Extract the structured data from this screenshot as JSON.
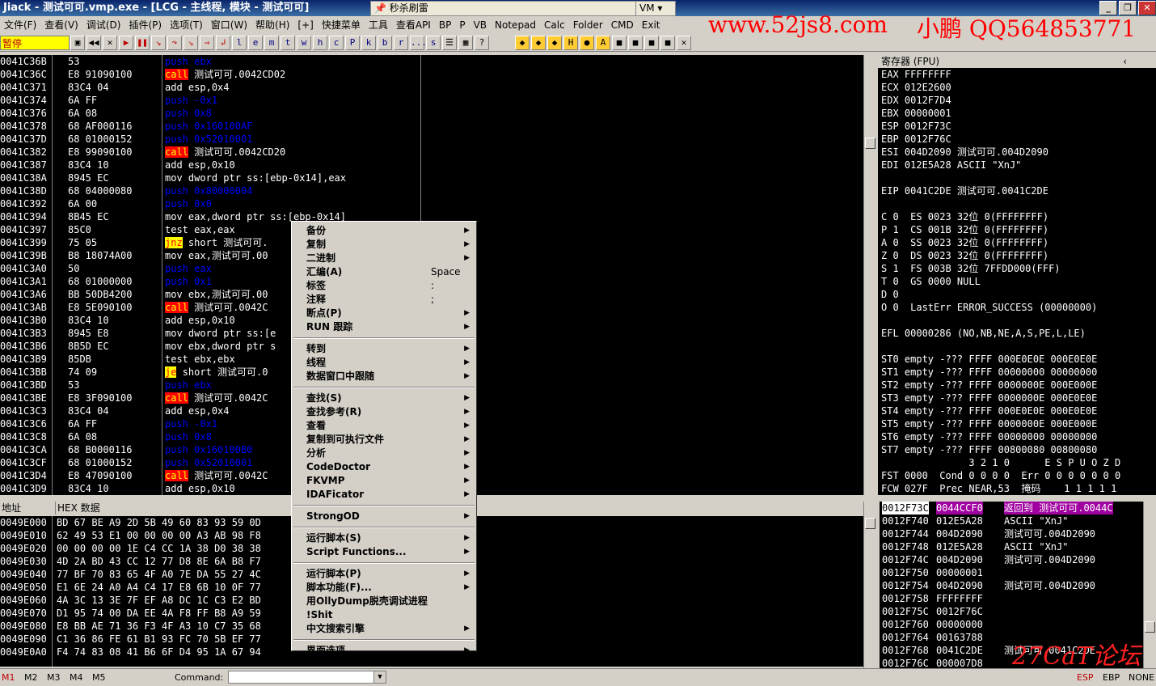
{
  "window": {
    "title": "Jiack  - 测试可可.vmp.exe - [LCG - 主线程, 模块 - 测试可可]",
    "task_button": "秒杀刷雷",
    "vm_label": "VM",
    "controls": [
      "_",
      "❐",
      "✕"
    ]
  },
  "watermark": {
    "site": "www.52js8.com",
    "author": "小鹏 QQ564853771",
    "forum": "27CaT论坛"
  },
  "menubar": [
    "文件(F)",
    "查看(V)",
    "调试(D)",
    "插件(P)",
    "选项(T)",
    "窗口(W)",
    "帮助(H)",
    "[+]",
    "快捷菜单",
    "工具",
    "查看API",
    "BP",
    "P",
    "VB",
    "Notepad",
    "Calc",
    "Folder",
    "CMD",
    "Exit"
  ],
  "toolbar": {
    "status": "暂停",
    "buttons": [
      "l",
      "e",
      "m",
      "t",
      "w",
      "h",
      "c",
      "P",
      "k",
      "b",
      "r",
      "...",
      "s"
    ]
  },
  "cpu": {
    "rows": [
      {
        "addr": "0041C36B",
        "hex": "53",
        "op": "push",
        "opk": "push",
        "arg": "ebx"
      },
      {
        "addr": "0041C36C",
        "hex": "E8 91090100",
        "op": "call",
        "opk": "call",
        "arg": "测试可可.0042CD02"
      },
      {
        "addr": "0041C371",
        "hex": "83C4 04",
        "op": "add",
        "opk": "add",
        "arg": "esp,0x4"
      },
      {
        "addr": "0041C374",
        "hex": "6A FF",
        "op": "push",
        "opk": "push",
        "arg": "-0x1"
      },
      {
        "addr": "0041C376",
        "hex": "6A 08",
        "op": "push",
        "opk": "push",
        "arg": "0x8"
      },
      {
        "addr": "0041C378",
        "hex": "68 AF000116",
        "op": "push",
        "opk": "push",
        "arg": "0x160100AF"
      },
      {
        "addr": "0041C37D",
        "hex": "68 01000152",
        "op": "push",
        "opk": "push",
        "arg": "0x52010001"
      },
      {
        "addr": "0041C382",
        "hex": "E8 99090100",
        "op": "call",
        "opk": "call",
        "arg": "测试可可.0042CD20"
      },
      {
        "addr": "0041C387",
        "hex": "83C4 10",
        "op": "add",
        "opk": "add",
        "arg": "esp,0x10"
      },
      {
        "addr": "0041C38A",
        "hex": "8945 EC",
        "op": "mov",
        "opk": "mov",
        "arg": "dword ptr ss:[ebp-0x14],eax"
      },
      {
        "addr": "0041C38D",
        "hex": "68 04000080",
        "op": "push",
        "opk": "push",
        "arg": "0x80000004"
      },
      {
        "addr": "0041C392",
        "hex": "6A 00",
        "op": "push",
        "opk": "push",
        "arg": "0x0"
      },
      {
        "addr": "0041C394",
        "hex": "8B45 EC",
        "op": "mov",
        "opk": "mov",
        "arg": "eax,dword ptr ss:[ebp-0x14]"
      },
      {
        "addr": "0041C397",
        "hex": "85C0",
        "op": "test",
        "opk": "mov",
        "arg": "eax,eax"
      },
      {
        "addr": "0041C399",
        "hex": "75 05",
        "op": "jnz",
        "opk": "jmp",
        "arg": "short 测试可可."
      },
      {
        "addr": "0041C39B",
        "hex": "B8 18074A00",
        "op": "mov",
        "opk": "mov",
        "arg": "eax,测试可可.00"
      },
      {
        "addr": "0041C3A0",
        "hex": "50",
        "op": "push",
        "opk": "push",
        "arg": "eax"
      },
      {
        "addr": "0041C3A1",
        "hex": "68 01000000",
        "op": "push",
        "opk": "push",
        "arg": "0x1"
      },
      {
        "addr": "0041C3A6",
        "hex": "BB 50DB4200",
        "op": "mov",
        "opk": "mov",
        "arg": "ebx,测试可可.00"
      },
      {
        "addr": "0041C3AB",
        "hex": "E8 5E090100",
        "op": "call",
        "opk": "call",
        "arg": "测试可可.0042C"
      },
      {
        "addr": "0041C3B0",
        "hex": "83C4 10",
        "op": "add",
        "opk": "add",
        "arg": "esp,0x10"
      },
      {
        "addr": "0041C3B3",
        "hex": "8945 E8",
        "op": "mov",
        "opk": "mov",
        "arg": "dword ptr ss:[e"
      },
      {
        "addr": "0041C3B6",
        "hex": "8B5D EC",
        "op": "mov",
        "opk": "mov",
        "arg": "ebx,dword ptr s"
      },
      {
        "addr": "0041C3B9",
        "hex": "85DB",
        "op": "test",
        "opk": "mov",
        "arg": "ebx,ebx"
      },
      {
        "addr": "0041C3BB",
        "hex": "74 09",
        "op": "je",
        "opk": "jmp",
        "arg": "short 测试可可.0"
      },
      {
        "addr": "0041C3BD",
        "hex": "53",
        "op": "push",
        "opk": "push",
        "arg": "ebx"
      },
      {
        "addr": "0041C3BE",
        "hex": "E8 3F090100",
        "op": "call",
        "opk": "call",
        "arg": "测试可可.0042C"
      },
      {
        "addr": "0041C3C3",
        "hex": "83C4 04",
        "op": "add",
        "opk": "add",
        "arg": "esp,0x4"
      },
      {
        "addr": "0041C3C6",
        "hex": "6A FF",
        "op": "push",
        "opk": "push",
        "arg": "-0x1"
      },
      {
        "addr": "0041C3C8",
        "hex": "6A 08",
        "op": "push",
        "opk": "push",
        "arg": "0x8"
      },
      {
        "addr": "0041C3CA",
        "hex": "68 B0000116",
        "op": "push",
        "opk": "push",
        "arg": "0x160100B0"
      },
      {
        "addr": "0041C3CF",
        "hex": "68 01000152",
        "op": "push",
        "opk": "push",
        "arg": "0x52010001"
      },
      {
        "addr": "0041C3D4",
        "hex": "E8 47090100",
        "op": "call",
        "opk": "call",
        "arg": "测试可可.0042C"
      },
      {
        "addr": "0041C3D9",
        "hex": "83C4 10",
        "op": "add",
        "opk": "add",
        "arg": "esp,0x10"
      }
    ]
  },
  "registers": {
    "header": "寄存器 (FPU)",
    "lines": [
      {
        "t": "EAX FFFFFFFF",
        "hl": false
      },
      {
        "t": "ECX 012E2600",
        "hl": false
      },
      {
        "t": "EDX 0012F7D4",
        "hl": false
      },
      {
        "t": "EBX 00000001",
        "hl": false
      },
      {
        "t": "ESP 0012F73C",
        "hl": true
      },
      {
        "t": "EBP 0012F76C",
        "hl": false
      },
      {
        "t": "ESI 004D2090 测试可可.004D2090",
        "hl": false
      },
      {
        "t": "EDI 012E5A28 ASCII \"XnJ\"",
        "hl": false
      },
      {
        "t": "",
        "hl": false
      },
      {
        "t": "EIP 0041C2DE 测试可可.0041C2DE",
        "hl": true
      },
      {
        "t": "",
        "hl": false
      },
      {
        "t": "C 0  ES 0023 32位 0(FFFFFFFF)",
        "hl": false
      },
      {
        "t": "P 1  CS 001B 32位 0(FFFFFFFF)",
        "hl": false
      },
      {
        "t": "A 0  SS 0023 32位 0(FFFFFFFF)",
        "hl": false
      },
      {
        "t": "Z 0  DS 0023 32位 0(FFFFFFFF)",
        "hl": false
      },
      {
        "t": "S 1  FS 003B 32位 7FFDD000(FFF)",
        "hl": false
      },
      {
        "t": "T 0  GS 0000 NULL",
        "hl": false
      },
      {
        "t": "D 0",
        "hl": false
      },
      {
        "t": "O 0  LastErr ERROR_SUCCESS (00000000)",
        "hl": false
      },
      {
        "t": "",
        "hl": false
      },
      {
        "t": "EFL 00000286 (NO,NB,NE,A,S,PE,L,LE)",
        "hl": false
      },
      {
        "t": "",
        "hl": false
      },
      {
        "t": "ST0 empty -??? FFFF 000E0E0E 000E0E0E",
        "hl": false
      },
      {
        "t": "ST1 empty -??? FFFF 00000000 00000000",
        "hl": false
      },
      {
        "t": "ST2 empty -??? FFFF 0000000E 000E000E",
        "hl": false
      },
      {
        "t": "ST3 empty -??? FFFF 0000000E 000E0E0E",
        "hl": false
      },
      {
        "t": "ST4 empty -??? FFFF 000E0E0E 000E0E0E",
        "hl": false
      },
      {
        "t": "ST5 empty -??? FFFF 0000000E 000E000E",
        "hl": false
      },
      {
        "t": "ST6 empty -??? FFFF 00000000 00000000",
        "hl": false
      },
      {
        "t": "ST7 empty -??? FFFF 00800080 00800080",
        "hl": false
      },
      {
        "t": "               3 2 1 0      E S P U O Z D",
        "hl": false
      },
      {
        "t": "FST 0000  Cond 0 0 0 0  Err 0 0 0 0 0 0 0",
        "hl": false
      },
      {
        "t": "FCW 027F  Prec NEAR,53  掩码    1 1 1 1 1",
        "hl": false
      }
    ]
  },
  "dump": {
    "col_addr": "地址",
    "col_hex": "HEX 数据",
    "rows": [
      {
        "a": "0049E000",
        "h": "BD 67 BE A9 2D 5B 49 60 83 93 59 0D"
      },
      {
        "a": "0049E010",
        "h": "62 49 53 E1 00 00 00 00 A3 AB 98 F8"
      },
      {
        "a": "0049E020",
        "h": "00 00 00 00 1E C4 CC 1A 38 D0 38 38"
      },
      {
        "a": "0049E030",
        "h": "4D 2A BD 43 CC 12 77 D8 8E 6A B8 F7"
      },
      {
        "a": "0049E040",
        "h": "77 BF 70 83 65 4F A0 7E DA 55 27 4C"
      },
      {
        "a": "0049E050",
        "h": "E1 6E 24 A0 A4 C4 17 E8 6B 10 0F 77"
      },
      {
        "a": "0049E060",
        "h": "4A 3C 13 3E 7F EF A8 DC 1C C3 E2 BD"
      },
      {
        "a": "0049E070",
        "h": "D1 95 74 00 DA EE 4A F8 FF B8 A9 59"
      },
      {
        "a": "0049E080",
        "h": "E8 BB AE 71 36 F3 4F A3 10 C7 35 68"
      },
      {
        "a": "0049E090",
        "h": "C1 36 86 FE 61 B1 93 FC 70 5B EF 77"
      },
      {
        "a": "0049E0A0",
        "h": "F4 74 83 08 41 B6 6F D4 95 1A 67 94"
      }
    ]
  },
  "stack": {
    "rows": [
      {
        "a": "0012F73C",
        "v": "0044CCF0",
        "c": "返回到 测试可可.0044C",
        "hl": true
      },
      {
        "a": "0012F740",
        "v": "012E5A28",
        "c": "ASCII \"XnJ\"",
        "hl": false
      },
      {
        "a": "0012F744",
        "v": "004D2090",
        "c": "测试可可.004D2090",
        "hl": false
      },
      {
        "a": "0012F748",
        "v": "012E5A28",
        "c": "ASCII \"XnJ\"",
        "hl": false
      },
      {
        "a": "0012F74C",
        "v": "004D2090",
        "c": "测试可可.004D2090",
        "hl": false
      },
      {
        "a": "0012F750",
        "v": "00000001",
        "c": "",
        "hl": false
      },
      {
        "a": "0012F754",
        "v": "004D2090",
        "c": "测试可可.004D2090",
        "hl": false
      },
      {
        "a": "0012F758",
        "v": "FFFFFFFF",
        "c": "",
        "hl": false
      },
      {
        "a": "0012F75C",
        "v": "0012F76C",
        "c": "",
        "hl": false
      },
      {
        "a": "0012F760",
        "v": "00000000",
        "c": "",
        "hl": false
      },
      {
        "a": "0012F764",
        "v": "00163788",
        "c": "",
        "hl": false
      },
      {
        "a": "0012F768",
        "v": "0041C2DE",
        "c": "测试可可.0041C2DE",
        "hl": false
      },
      {
        "a": "0012F76C",
        "v": "000007D8",
        "c": "",
        "hl": false
      }
    ]
  },
  "context_menu": {
    "items": [
      {
        "l": "备份",
        "s": "",
        "sub": true
      },
      {
        "l": "复制",
        "s": "",
        "sub": true
      },
      {
        "l": "二进制",
        "s": "",
        "sub": true
      },
      {
        "l": "汇编(A)",
        "s": "Space",
        "sub": false
      },
      {
        "l": "标签",
        "s": ":",
        "sub": false
      },
      {
        "l": "注释",
        "s": ";",
        "sub": false
      },
      {
        "l": "断点(P)",
        "s": "",
        "sub": true
      },
      {
        "l": "RUN 跟踪",
        "s": "",
        "sub": true
      },
      {
        "sep": true
      },
      {
        "l": "转到",
        "s": "",
        "sub": true
      },
      {
        "l": "线程",
        "s": "",
        "sub": true
      },
      {
        "l": "数据窗口中跟随",
        "s": "",
        "sub": true
      },
      {
        "sep": true
      },
      {
        "l": "查找(S)",
        "s": "",
        "sub": true
      },
      {
        "l": "查找参考(R)",
        "s": "",
        "sub": true
      },
      {
        "l": "查看",
        "s": "",
        "sub": true
      },
      {
        "l": "复制到可执行文件",
        "s": "",
        "sub": true
      },
      {
        "l": "分析",
        "s": "",
        "sub": true
      },
      {
        "l": "CodeDoctor",
        "s": "",
        "sub": true
      },
      {
        "l": "FKVMP",
        "s": "",
        "sub": true
      },
      {
        "l": "IDAFicator",
        "s": "",
        "sub": true
      },
      {
        "sep": true
      },
      {
        "l": "StrongOD",
        "s": "",
        "sub": true
      },
      {
        "sep": true
      },
      {
        "l": "运行脚本(S)",
        "s": "",
        "sub": true
      },
      {
        "l": "Script Functions...",
        "s": "",
        "sub": true
      },
      {
        "sep": true
      },
      {
        "l": "运行脚本(P)",
        "s": "",
        "sub": true
      },
      {
        "l": "脚本功能(F)...",
        "s": "",
        "sub": true
      },
      {
        "l": "用OllyDump脱壳调试进程",
        "s": "",
        "sub": false
      },
      {
        "l": "!Shit",
        "s": "",
        "sub": false
      },
      {
        "l": "中文搜索引擎",
        "s": "",
        "sub": true
      },
      {
        "sep": true
      },
      {
        "l": "界面选项",
        "s": "",
        "sub": true
      }
    ]
  },
  "statusbar": {
    "tabs": [
      "M1",
      "M2",
      "M3",
      "M4",
      "M5"
    ],
    "command_label": "Command:",
    "right": [
      "ESP",
      "EBP",
      "NONE"
    ]
  }
}
